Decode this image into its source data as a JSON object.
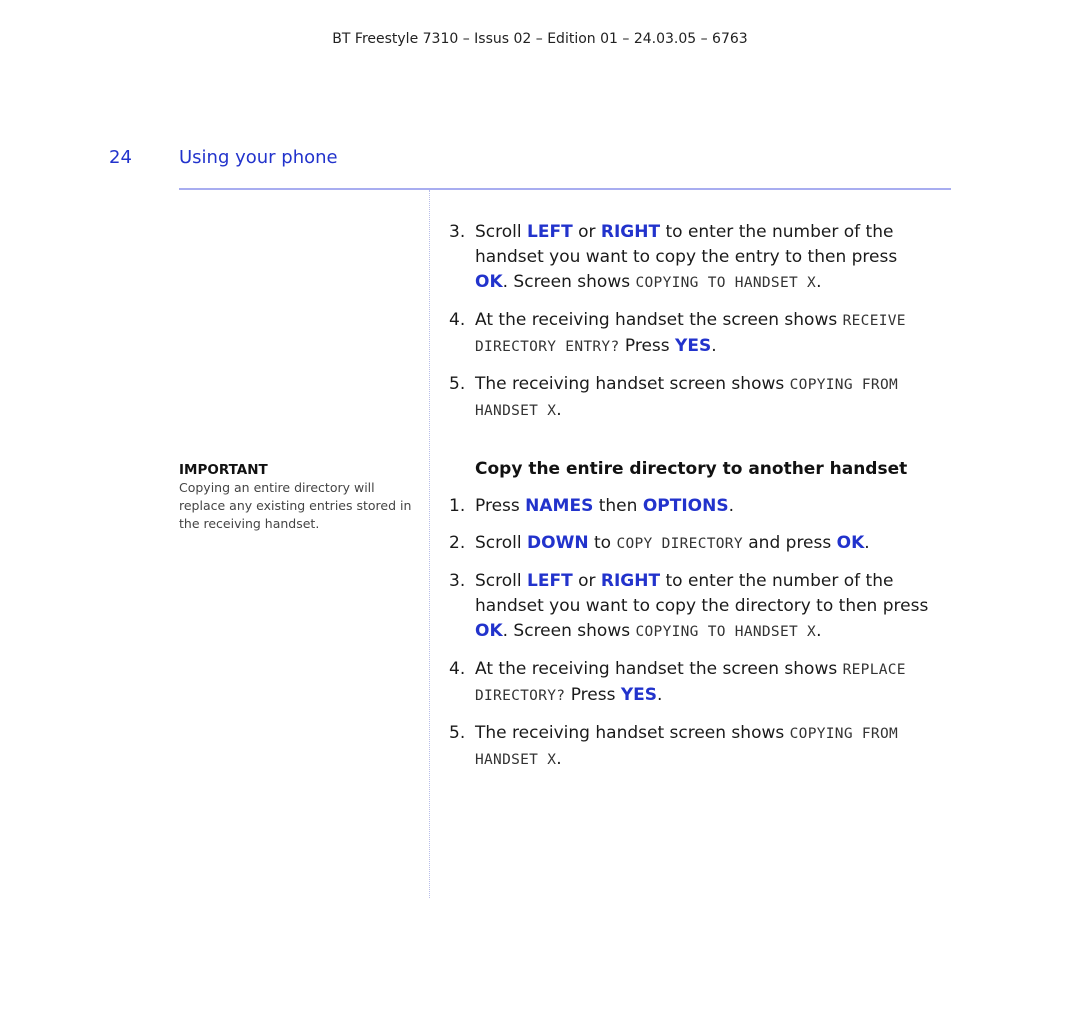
{
  "header": {
    "text": "BT Freestyle 7310 – Issus 02 – Edition 01 – 24.03.05 – 6763"
  },
  "page": {
    "number": "24",
    "section_title": "Using your phone"
  },
  "aside": {
    "title": "IMPORTANT",
    "body": "Copying an entire directory will replace any existing entries stored in the receiving handset."
  },
  "part1": {
    "steps": [
      {
        "num": "3.",
        "segs": [
          {
            "t": "Scroll "
          },
          {
            "k": "LEFT"
          },
          {
            "t": " or "
          },
          {
            "k": "RIGHT"
          },
          {
            "t": " to enter the number of the handset you want to copy the entry to then press "
          },
          {
            "k": "OK"
          },
          {
            "t": ". Screen shows "
          },
          {
            "l": "COPYING TO HANDSET X"
          },
          {
            "t": "."
          }
        ]
      },
      {
        "num": "4.",
        "segs": [
          {
            "t": "At the receiving handset the screen shows "
          },
          {
            "l": "RECEIVE DIRECTORY ENTRY?"
          },
          {
            "t": " Press "
          },
          {
            "k": "YES"
          },
          {
            "t": "."
          }
        ]
      },
      {
        "num": "5.",
        "segs": [
          {
            "t": "The receiving handset screen shows "
          },
          {
            "l": "COPYING FROM HANDSET X"
          },
          {
            "t": "."
          }
        ]
      }
    ]
  },
  "part2": {
    "heading": "Copy the entire directory to another handset",
    "steps": [
      {
        "num": "1.",
        "segs": [
          {
            "t": "Press "
          },
          {
            "k": "NAMES"
          },
          {
            "t": " then "
          },
          {
            "k": "OPTIONS"
          },
          {
            "t": "."
          }
        ]
      },
      {
        "num": "2.",
        "segs": [
          {
            "t": "Scroll "
          },
          {
            "k": "DOWN"
          },
          {
            "t": " to "
          },
          {
            "l": "COPY DIRECTORY"
          },
          {
            "t": " and press "
          },
          {
            "k": "OK"
          },
          {
            "t": "."
          }
        ]
      },
      {
        "num": "3.",
        "segs": [
          {
            "t": "Scroll "
          },
          {
            "k": "LEFT"
          },
          {
            "t": " or "
          },
          {
            "k": "RIGHT"
          },
          {
            "t": " to enter the number of the handset you want to copy the directory to then press "
          },
          {
            "k": "OK"
          },
          {
            "t": ". Screen shows "
          },
          {
            "l": "COPYING TO HANDSET X"
          },
          {
            "t": "."
          }
        ]
      },
      {
        "num": "4.",
        "segs": [
          {
            "t": "At the receiving handset the screen shows "
          },
          {
            "l": "REPLACE DIRECTORY?"
          },
          {
            "t": " Press "
          },
          {
            "k": "YES"
          },
          {
            "t": "."
          }
        ]
      },
      {
        "num": "5.",
        "segs": [
          {
            "t": "The receiving handset screen shows "
          },
          {
            "l": "COPYING FROM HANDSET X"
          },
          {
            "t": "."
          }
        ]
      }
    ]
  },
  "colors": {
    "accent": "#2233cc",
    "rule": "#a8adf0"
  }
}
